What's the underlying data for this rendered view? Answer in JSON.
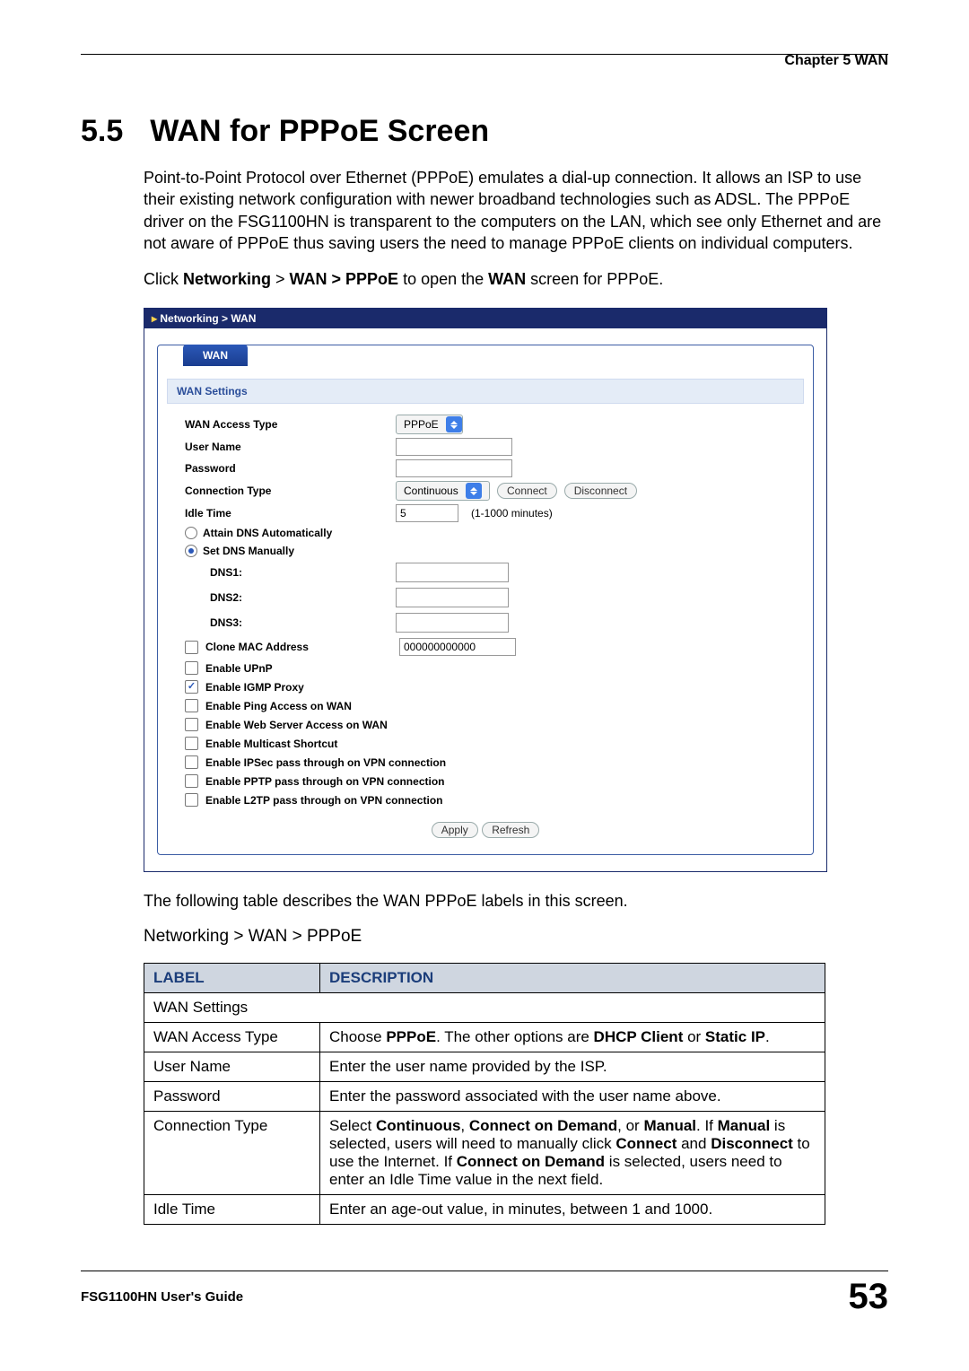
{
  "header": {
    "chapter": "Chapter 5 WAN"
  },
  "section": {
    "number": "5.5",
    "title": "WAN for PPPoE Screen"
  },
  "paragraphs": {
    "intro": "Point-to-Point Protocol over Ethernet (PPPoE) emulates a dial-up connection. It allows an ISP to use their existing network configuration with newer broadband technologies such as ADSL. The PPPoE driver on the FSG1100HN is transparent to the computers on the LAN, which see only Ethernet and are not aware of PPPoE thus saving users the need to manage PPPoE clients on individual computers.",
    "click_pre": "Click ",
    "click_bold1": "Networking",
    "click_mid": " > ",
    "click_bold2": "WAN > PPPoE",
    "click_post1": " to open the ",
    "click_bold3": "WAN",
    "click_post2": " screen for PPPoE.",
    "table_intro": "The following table describes the WAN PPPoE labels in this screen.",
    "table_caption": "Networking > WAN > PPPoE"
  },
  "screenshot": {
    "breadcrumb": "Networking > WAN",
    "tab": "WAN",
    "section_title": "WAN Settings",
    "rows": {
      "access": {
        "label": "WAN Access Type",
        "value": "PPPoE"
      },
      "user": {
        "label": "User Name",
        "value": ""
      },
      "pass": {
        "label": "Password",
        "value": ""
      },
      "conn": {
        "label": "Connection Type",
        "value": "Continuous",
        "btn_connect": "Connect",
        "btn_disconnect": "Disconnect"
      },
      "idle": {
        "label": "Idle Time",
        "value": "5",
        "hint": "(1-1000 minutes)"
      }
    },
    "dns": {
      "auto": "Attain DNS Automatically",
      "manual": "Set DNS Manually",
      "dns1": "DNS1:",
      "dns2": "DNS2:",
      "dns3": "DNS3:"
    },
    "clone": {
      "label": "Clone MAC Address",
      "value": "000000000000"
    },
    "checks": {
      "upnp": "Enable UPnP",
      "igmp": "Enable IGMP Proxy",
      "ping": "Enable Ping Access on WAN",
      "web": "Enable Web Server Access on WAN",
      "mc": "Enable Multicast Shortcut",
      "ipsec": "Enable IPSec pass through on VPN connection",
      "pptp": "Enable PPTP pass through on VPN connection",
      "l2tp": "Enable L2TP pass through on VPN connection"
    },
    "actions": {
      "apply": "Apply",
      "refresh": "Refresh"
    }
  },
  "table": {
    "head": {
      "label": "LABEL",
      "desc": "DESCRIPTION"
    },
    "rows": {
      "r0": {
        "label": "WAN Settings",
        "desc": ""
      },
      "r1": {
        "label": "WAN Access Type",
        "pre": "Choose ",
        "b1": "PPPoE",
        "mid": ". The other options are ",
        "b2": "DHCP Client",
        "mid2": " or ",
        "b3": "Static IP",
        "post": "."
      },
      "r2": {
        "label": "User Name",
        "desc": "Enter the user name provided by the ISP."
      },
      "r3": {
        "label": "Password",
        "desc": "Enter the password associated with the user name above."
      },
      "r4": {
        "label": "Connection Type",
        "pre": "Select ",
        "b1": "Continuous",
        "c1": ", ",
        "b2": "Connect on Demand",
        "c2": ", or ",
        "b3": "Manual",
        "c3": ". If ",
        "b4": "Manual",
        "c4": " is selected, users will need to manually click ",
        "b5": "Connect",
        "c5": " and ",
        "b6": "Disconnect",
        "c6": " to use the Internet. If ",
        "b7": "Connect on Demand",
        "c7": " is selected, users need to enter an Idle Time value in the next field."
      },
      "r5": {
        "label": "Idle Time",
        "desc": "Enter an age-out value, in minutes, between 1 and 1000."
      }
    }
  },
  "footer": {
    "guide": "FSG1100HN User's Guide",
    "page": "53"
  }
}
